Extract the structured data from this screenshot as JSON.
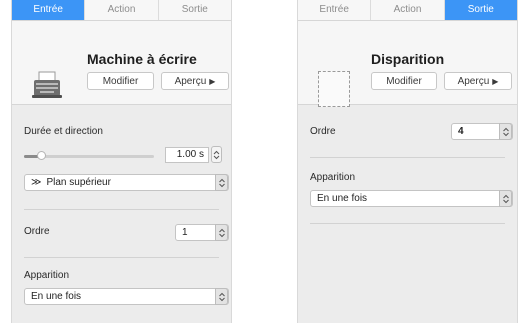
{
  "left_panel": {
    "tabs": [
      {
        "label": "Entrée",
        "active": true
      },
      {
        "label": "Action",
        "active": false
      },
      {
        "label": "Sortie",
        "active": false
      }
    ],
    "effect_icon": "typewriter-icon",
    "effect_title": "Machine à écrire",
    "modify_label": "Modifier",
    "preview_label": "Aperçu",
    "duration_label": "Durée et direction",
    "duration_value": "1.00 s",
    "duration_fraction": 0.13,
    "direction_value": "Plan supérieur",
    "direction_icon": "double-chevron-right-icon",
    "order_label": "Ordre",
    "order_value": "1",
    "appearance_label": "Apparition",
    "appearance_value": "En une fois"
  },
  "right_panel": {
    "tabs": [
      {
        "label": "Entrée",
        "active": false
      },
      {
        "label": "Action",
        "active": false
      },
      {
        "label": "Sortie",
        "active": true
      }
    ],
    "effect_icon": "dashed-placeholder-icon",
    "effect_title": "Disparition",
    "modify_label": "Modifier",
    "preview_label": "Aperçu",
    "order_label": "Ordre",
    "order_value": "4",
    "appearance_label": "Apparition",
    "appearance_value": "En une fois"
  },
  "colors": {
    "active_tab": "#3c95f6",
    "panel_bg": "#ececec"
  }
}
